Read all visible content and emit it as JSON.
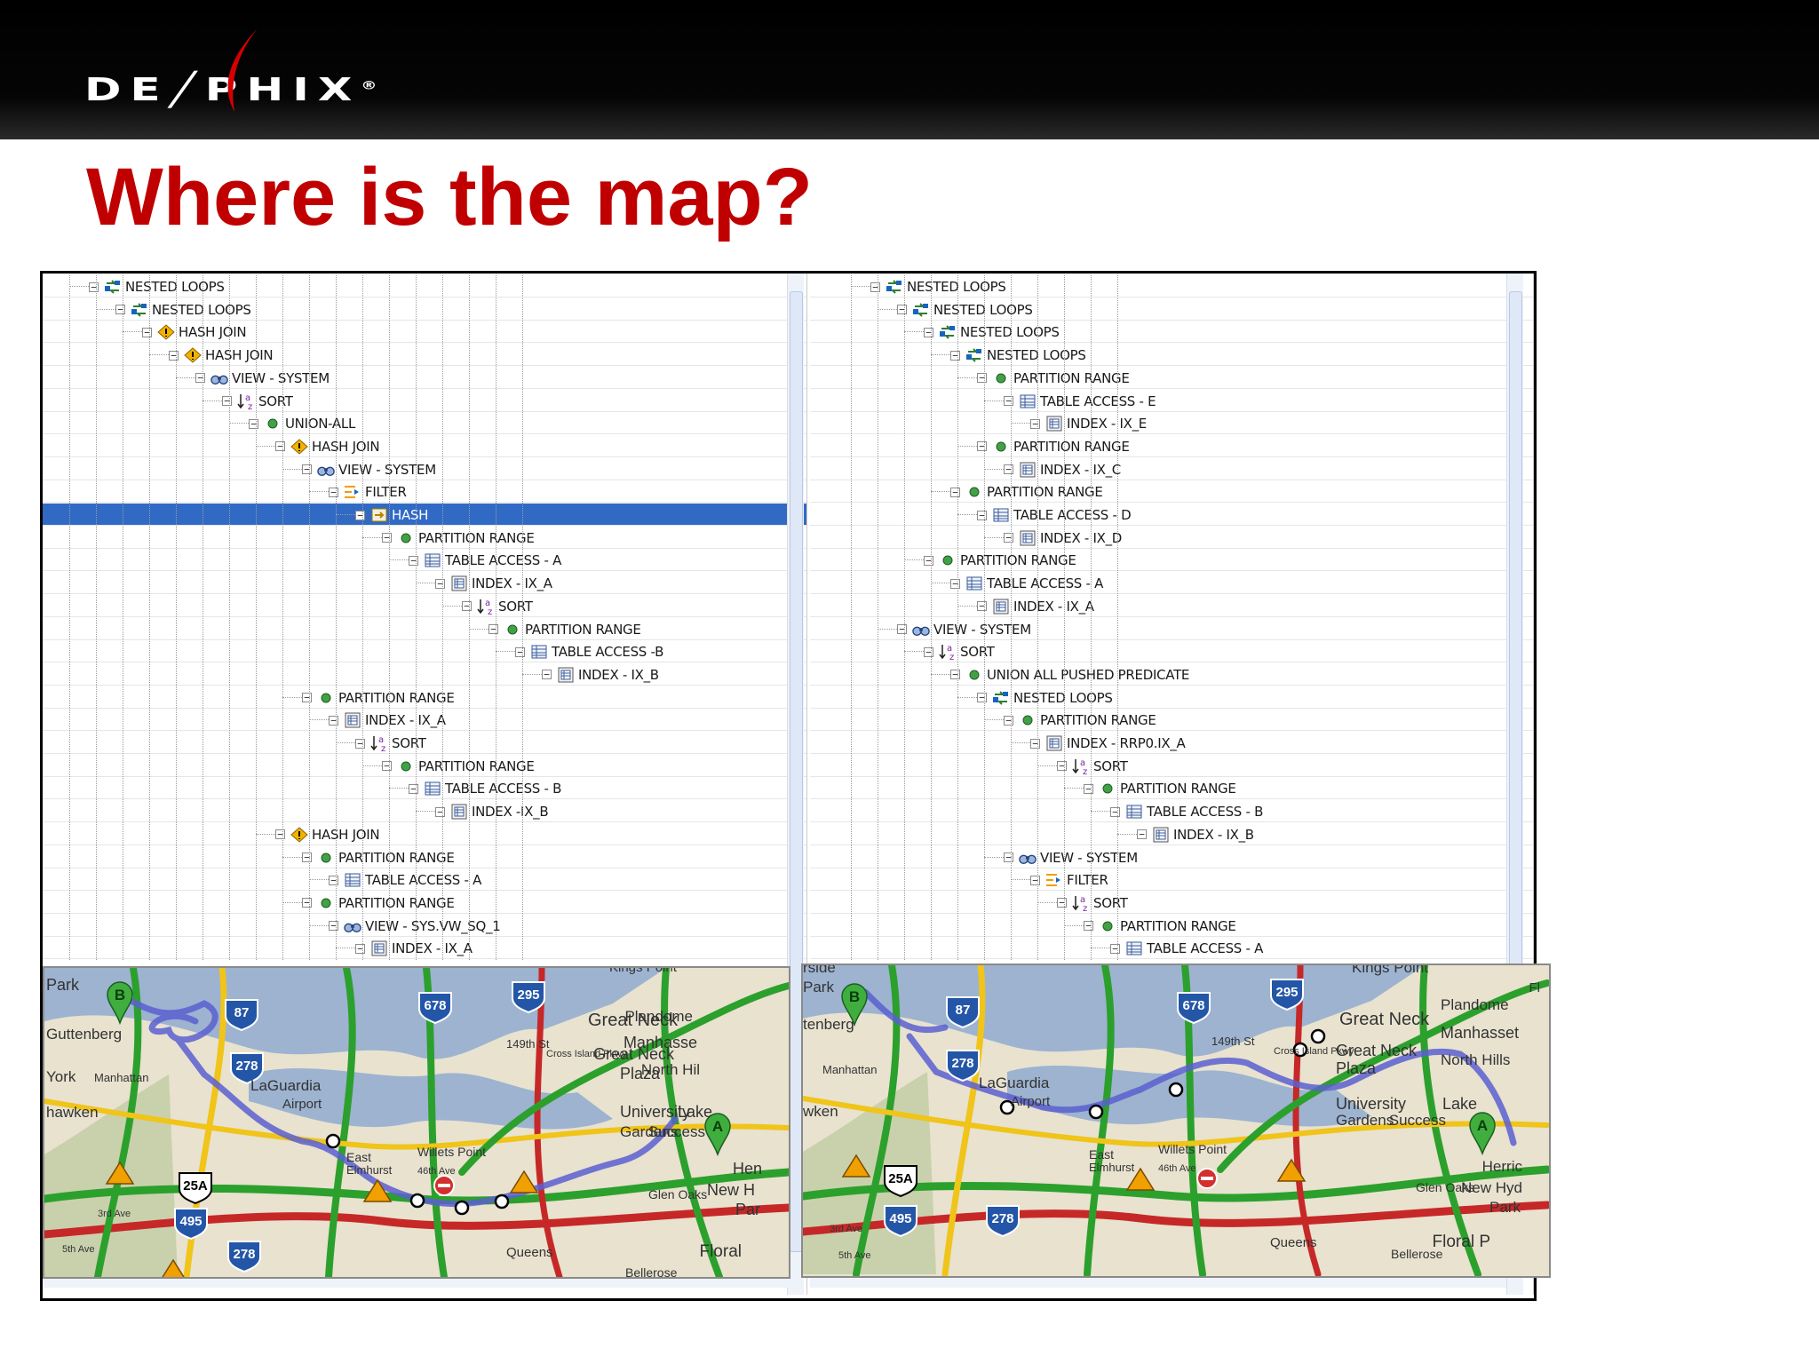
{
  "slide": {
    "logo": "DE╱PHIX",
    "trademark": "®",
    "title": "Where is the map?"
  },
  "colors": {
    "title": "#c00000",
    "selection": "#316ac5",
    "header": "#000000"
  },
  "left_plan": [
    {
      "depth": 0,
      "icon": "nested-loops-icon",
      "label": "NESTED LOOPS"
    },
    {
      "depth": 1,
      "icon": "nested-loops-icon",
      "label": "NESTED LOOPS"
    },
    {
      "depth": 2,
      "icon": "hash-join-icon",
      "label": "HASH JOIN"
    },
    {
      "depth": 3,
      "icon": "hash-join-icon",
      "label": "HASH JOIN"
    },
    {
      "depth": 4,
      "icon": "view-icon",
      "label": "VIEW - SYSTEM"
    },
    {
      "depth": 5,
      "icon": "sort-icon",
      "label": "SORT"
    },
    {
      "depth": 6,
      "icon": "partition-icon",
      "label": "UNION-ALL"
    },
    {
      "depth": 7,
      "icon": "hash-join-icon",
      "label": "HASH JOIN"
    },
    {
      "depth": 8,
      "icon": "view-icon",
      "label": "VIEW - SYSTEM"
    },
    {
      "depth": 9,
      "icon": "filter-icon",
      "label": "FILTER"
    },
    {
      "depth": 10,
      "icon": "hash-icon",
      "label": "HASH",
      "selected": true
    },
    {
      "depth": 11,
      "icon": "partition-icon",
      "label": "PARTITION RANGE"
    },
    {
      "depth": 12,
      "icon": "table-icon",
      "label": "TABLE ACCESS - A"
    },
    {
      "depth": 13,
      "icon": "index-icon",
      "label": "INDEX - IX_A"
    },
    {
      "depth": 14,
      "icon": "sort-icon",
      "label": "SORT"
    },
    {
      "depth": 15,
      "icon": "partition-icon",
      "label": "PARTITION RANGE"
    },
    {
      "depth": 16,
      "icon": "table-icon",
      "label": "TABLE ACCESS -B"
    },
    {
      "depth": 17,
      "icon": "index-icon",
      "label": "INDEX - IX_B"
    },
    {
      "depth": 8,
      "icon": "partition-icon",
      "label": "PARTITION RANGE"
    },
    {
      "depth": 9,
      "icon": "index-icon",
      "label": "INDEX - IX_A"
    },
    {
      "depth": 10,
      "icon": "sort-icon",
      "label": "SORT"
    },
    {
      "depth": 11,
      "icon": "partition-icon",
      "label": "PARTITION RANGE"
    },
    {
      "depth": 12,
      "icon": "table-icon",
      "label": "TABLE ACCESS - B"
    },
    {
      "depth": 13,
      "icon": "index-icon",
      "label": "INDEX -IX_B"
    },
    {
      "depth": 7,
      "icon": "hash-join-icon",
      "label": "HASH JOIN"
    },
    {
      "depth": 8,
      "icon": "partition-icon",
      "label": "PARTITION RANGE"
    },
    {
      "depth": 9,
      "icon": "table-icon",
      "label": "TABLE ACCESS - A"
    },
    {
      "depth": 8,
      "icon": "partition-icon",
      "label": "PARTITION RANGE"
    },
    {
      "depth": 9,
      "icon": "view-icon",
      "label": "VIEW - SYS.VW_SQ_1"
    },
    {
      "depth": 10,
      "icon": "index-icon",
      "label": "INDEX - IX_A"
    }
  ],
  "right_plan": [
    {
      "depth": 0,
      "icon": "nested-loops-icon",
      "label": "NESTED LOOPS"
    },
    {
      "depth": 1,
      "icon": "nested-loops-icon",
      "label": "NESTED LOOPS"
    },
    {
      "depth": 2,
      "icon": "nested-loops-icon",
      "label": "NESTED LOOPS"
    },
    {
      "depth": 3,
      "icon": "nested-loops-icon",
      "label": "NESTED LOOPS"
    },
    {
      "depth": 4,
      "icon": "partition-icon",
      "label": "PARTITION RANGE"
    },
    {
      "depth": 5,
      "icon": "table-icon",
      "label": "TABLE ACCESS - E"
    },
    {
      "depth": 6,
      "icon": "index-icon",
      "label": "INDEX - IX_E"
    },
    {
      "depth": 4,
      "icon": "partition-icon",
      "label": "PARTITION RANGE"
    },
    {
      "depth": 5,
      "icon": "index-icon",
      "label": "INDEX - IX_C"
    },
    {
      "depth": 3,
      "icon": "partition-icon",
      "label": "PARTITION RANGE"
    },
    {
      "depth": 4,
      "icon": "table-icon",
      "label": "TABLE ACCESS - D"
    },
    {
      "depth": 5,
      "icon": "index-icon",
      "label": "INDEX - IX_D"
    },
    {
      "depth": 2,
      "icon": "partition-icon",
      "label": "PARTITION RANGE"
    },
    {
      "depth": 3,
      "icon": "table-icon",
      "label": "TABLE ACCESS - A"
    },
    {
      "depth": 4,
      "icon": "index-icon",
      "label": "INDEX - IX_A"
    },
    {
      "depth": 1,
      "icon": "view-icon",
      "label": "VIEW - SYSTEM"
    },
    {
      "depth": 2,
      "icon": "sort-icon",
      "label": "SORT"
    },
    {
      "depth": 3,
      "icon": "partition-icon",
      "label": "UNION ALL PUSHED PREDICATE"
    },
    {
      "depth": 4,
      "icon": "nested-loops-icon",
      "label": "NESTED LOOPS"
    },
    {
      "depth": 5,
      "icon": "partition-icon",
      "label": "PARTITION RANGE"
    },
    {
      "depth": 6,
      "icon": "index-icon",
      "label": "INDEX - RRP0.IX_A"
    },
    {
      "depth": 7,
      "icon": "sort-icon",
      "label": "SORT"
    },
    {
      "depth": 8,
      "icon": "partition-icon",
      "label": "PARTITION RANGE"
    },
    {
      "depth": 9,
      "icon": "table-icon",
      "label": "TABLE ACCESS - B"
    },
    {
      "depth": 10,
      "icon": "index-icon",
      "label": "INDEX - IX_B"
    },
    {
      "depth": 5,
      "icon": "view-icon",
      "label": "VIEW - SYSTEM"
    },
    {
      "depth": 6,
      "icon": "filter-icon",
      "label": "FILTER"
    },
    {
      "depth": 7,
      "icon": "sort-icon",
      "label": "SORT"
    },
    {
      "depth": 8,
      "icon": "partition-icon",
      "label": "PARTITION RANGE"
    },
    {
      "depth": 9,
      "icon": "table-icon",
      "label": "TABLE ACCESS - A"
    }
  ],
  "left_map": {
    "places": [
      "Park",
      "Guttenberg",
      "Manhattan",
      "York",
      "hawken",
      "LaGuardia",
      "Airport",
      "East",
      "Elmhurst",
      "Willets Point",
      "46th Ave",
      "Great Neck",
      "Great Neck",
      "Plaza",
      "Plandome",
      "Manhasse",
      "North Hil",
      "University",
      "Gardens",
      "Lake",
      "Success",
      "Hen",
      "New H",
      "Par",
      "Queens",
      "Floral",
      "Glen Oaks",
      "Bellerose",
      "Kings Point",
      "149th St",
      "Cross Island Pkwy",
      "3rd Ave",
      "5th Ave"
    ],
    "shields": [
      "87",
      "278",
      "678",
      "295",
      "25A",
      "495",
      "278"
    ],
    "markers": [
      "B",
      "A"
    ]
  },
  "right_map": {
    "places": [
      "rside",
      "Park",
      "tenberg",
      "Manhattan",
      "wken",
      "LaGuardia",
      "Airport",
      "East",
      "Elmhurst",
      "Willets Point",
      "46th Ave",
      "Kings Point",
      "Great Neck",
      "Great Neck",
      "Plaza",
      "Plandome",
      "Manhasset",
      "North Hills",
      "University",
      "Gardens",
      "Lake",
      "Success",
      "Herric",
      "New Hyd",
      "Park",
      "Queens",
      "Floral P",
      "Glen Oaks",
      "Bellerose",
      "Fl",
      "149th St",
      "Cross Island Pkwy",
      "3rd Ave",
      "5th Ave"
    ],
    "shields": [
      "87",
      "278",
      "678",
      "295",
      "25A",
      "495",
      "278"
    ],
    "markers": [
      "B",
      "A"
    ]
  }
}
